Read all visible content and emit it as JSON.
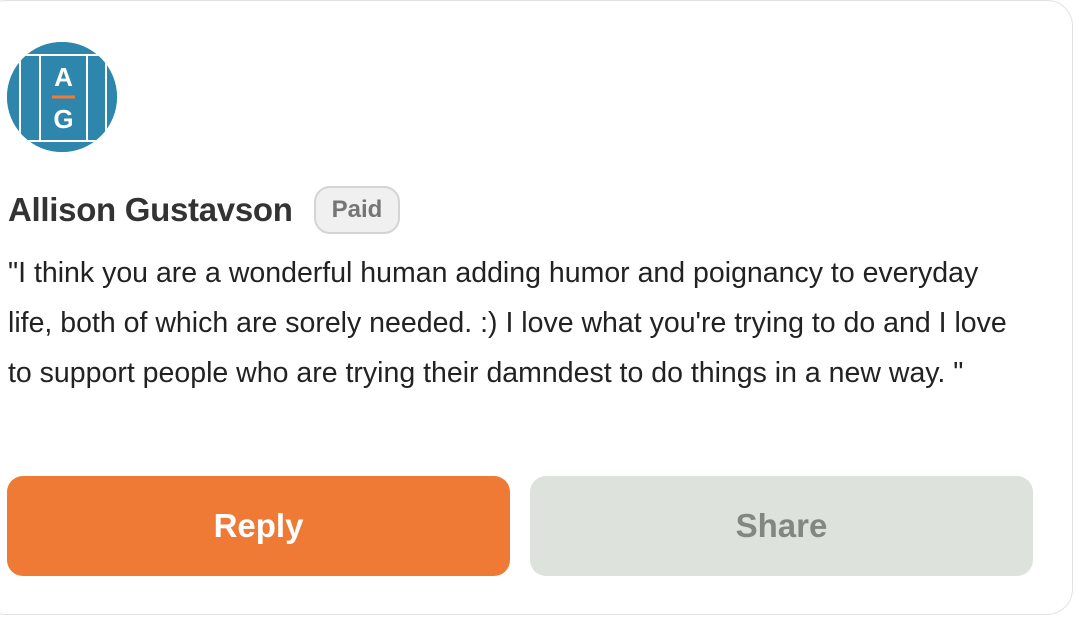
{
  "comment": {
    "avatar": {
      "initials_top": "A",
      "initials_bottom": "G",
      "icon": "avatar-monogram",
      "background_color": "#2e86ad",
      "accent_color": "#ef7a36"
    },
    "author_name": "Allison Gustavson",
    "badge_label": "Paid",
    "text": "\"I think you are a wonderful human adding humor and poignancy to everyday life, both of which are sorely needed. :) I love what you're trying to do and I love to support people who are trying their damndest to do things in a new way. \""
  },
  "actions": {
    "reply_label": "Reply",
    "share_label": "Share",
    "reply_color": "#ef7a36",
    "share_color": "#dde3dc"
  }
}
